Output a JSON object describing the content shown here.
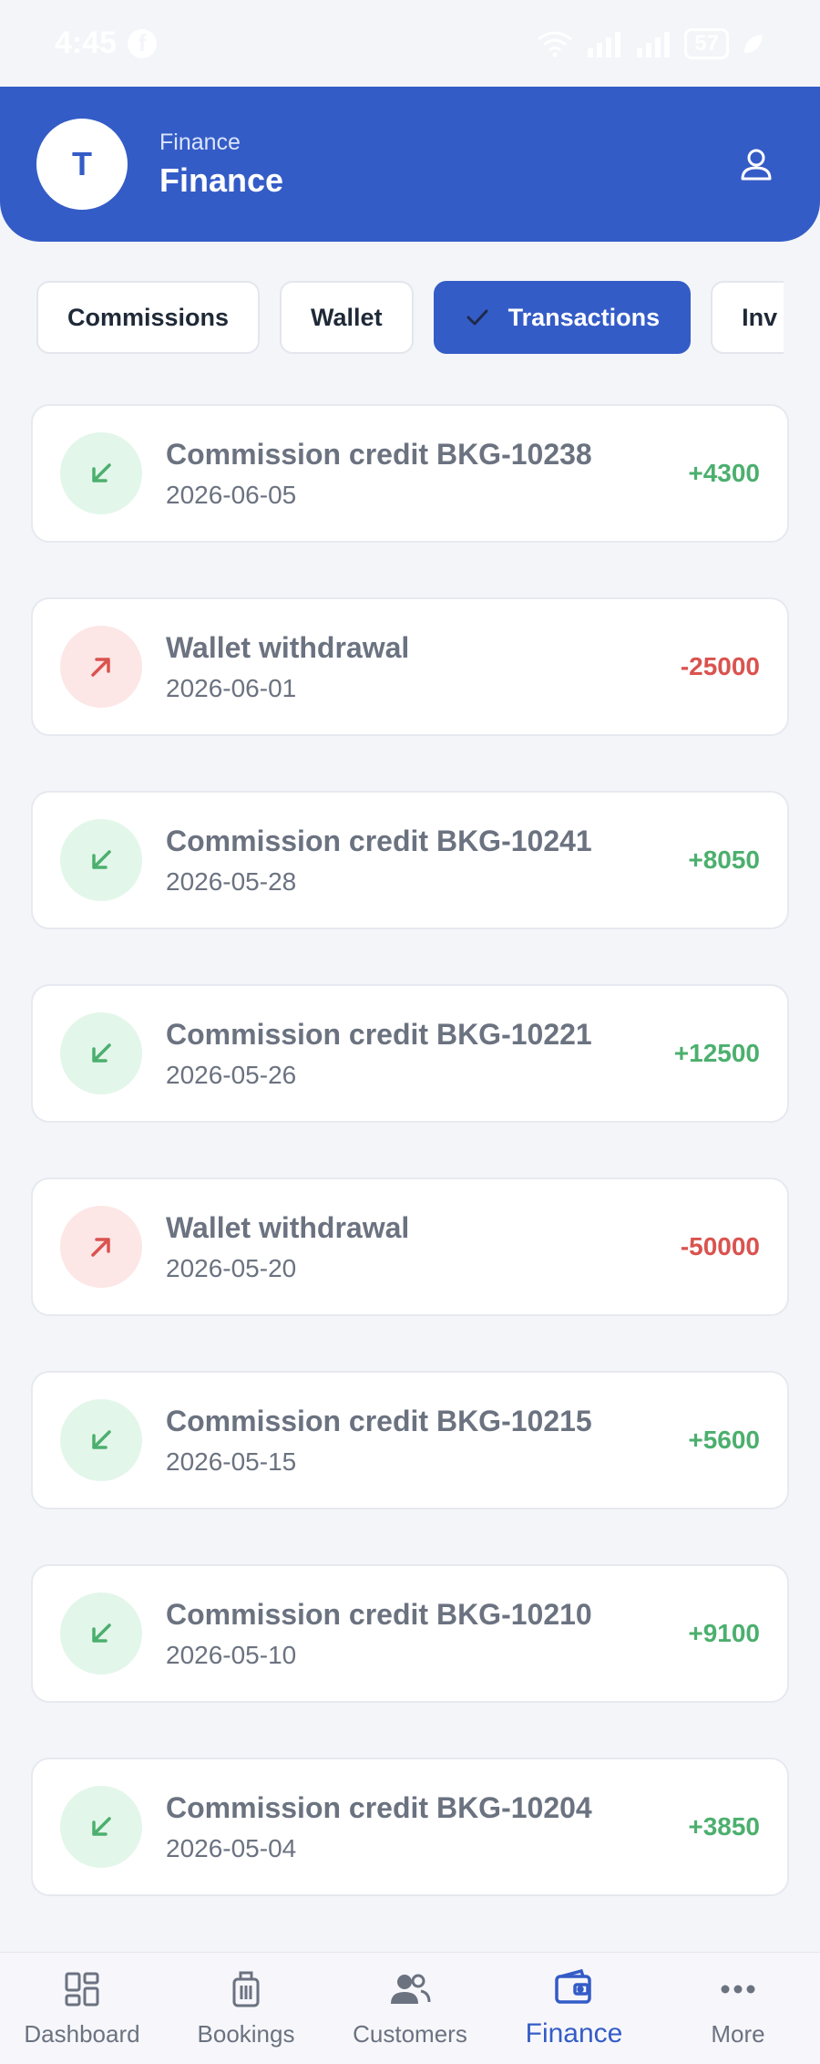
{
  "status_bar": {
    "time": "4:45",
    "battery": "57"
  },
  "header": {
    "avatar_initial": "T",
    "subtitle": "Finance",
    "title": "Finance"
  },
  "tabs": [
    {
      "label": "Commissions",
      "active": false
    },
    {
      "label": "Wallet",
      "active": false
    },
    {
      "label": "Transactions",
      "active": true
    },
    {
      "label": "Inv",
      "active": false
    }
  ],
  "transactions": [
    {
      "title": "Commission credit BKG-10238",
      "date": "2026-06-05",
      "amount": "+4300",
      "kind": "credit"
    },
    {
      "title": "Wallet withdrawal",
      "date": "2026-06-01",
      "amount": "-25000",
      "kind": "debit"
    },
    {
      "title": "Commission credit BKG-10241",
      "date": "2026-05-28",
      "amount": "+8050",
      "kind": "credit"
    },
    {
      "title": "Commission credit BKG-10221",
      "date": "2026-05-26",
      "amount": "+12500",
      "kind": "credit"
    },
    {
      "title": "Wallet withdrawal",
      "date": "2026-05-20",
      "amount": "-50000",
      "kind": "debit"
    },
    {
      "title": "Commission credit BKG-10215",
      "date": "2026-05-15",
      "amount": "+5600",
      "kind": "credit"
    },
    {
      "title": "Commission credit BKG-10210",
      "date": "2026-05-10",
      "amount": "+9100",
      "kind": "credit"
    },
    {
      "title": "Commission credit BKG-10204",
      "date": "2026-05-04",
      "amount": "+3850",
      "kind": "credit"
    }
  ],
  "nav": [
    {
      "label": "Dashboard",
      "icon": "dashboard-icon",
      "active": false
    },
    {
      "label": "Bookings",
      "icon": "luggage-icon",
      "active": false
    },
    {
      "label": "Customers",
      "icon": "people-icon",
      "active": false
    },
    {
      "label": "Finance",
      "icon": "wallet-icon",
      "active": true
    },
    {
      "label": "More",
      "icon": "more-icon",
      "active": false
    }
  ],
  "colors": {
    "primary": "#345cc7",
    "credit": "#4caf6e",
    "debit": "#d9534f",
    "background": "#f3f5f9"
  }
}
